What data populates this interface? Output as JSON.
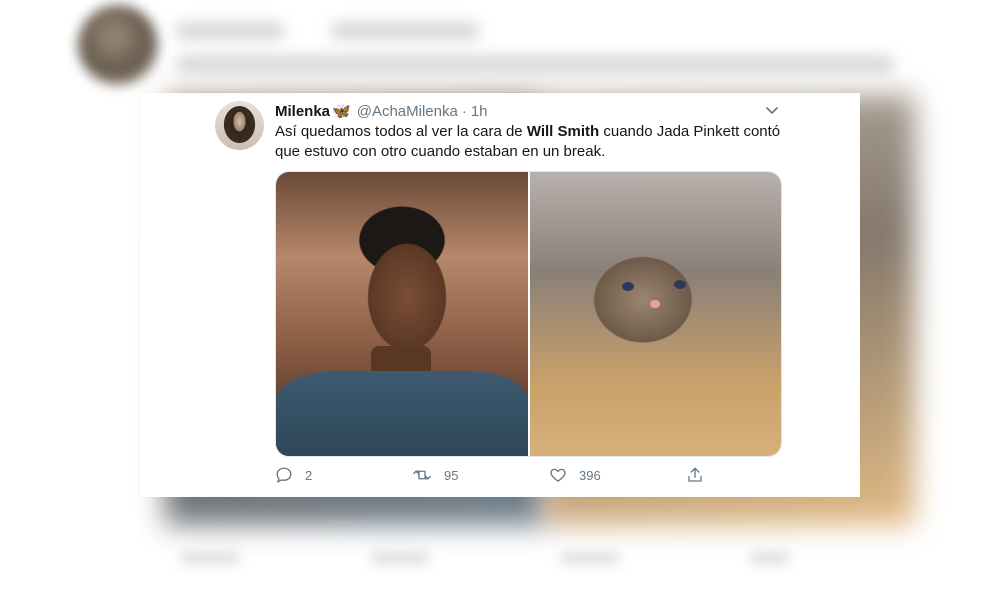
{
  "tweet": {
    "display_name": "Milenka",
    "name_emoji": "🦋",
    "handle": "@AchaMilenka",
    "separator": "·",
    "time": "1h",
    "text_before": "Así quedamos todos al ver la cara de ",
    "text_bold": "Will Smith",
    "text_after": " cuando Jada Pinkett contó que estuvo con otro cuando estaban en un break.",
    "replies": "2",
    "retweets": "95",
    "likes": "396",
    "media": [
      {
        "icon": "man-photo",
        "subject": "man"
      },
      {
        "icon": "crying-cat-photo",
        "subject": "cat"
      }
    ]
  },
  "colors": {
    "text": "#14171a",
    "muted": "#657786",
    "accent": "#1d9bf0"
  },
  "icons": [
    "reply-icon",
    "retweet-icon",
    "like-icon",
    "share-icon",
    "chevron-down-icon",
    "butterfly-icon"
  ]
}
